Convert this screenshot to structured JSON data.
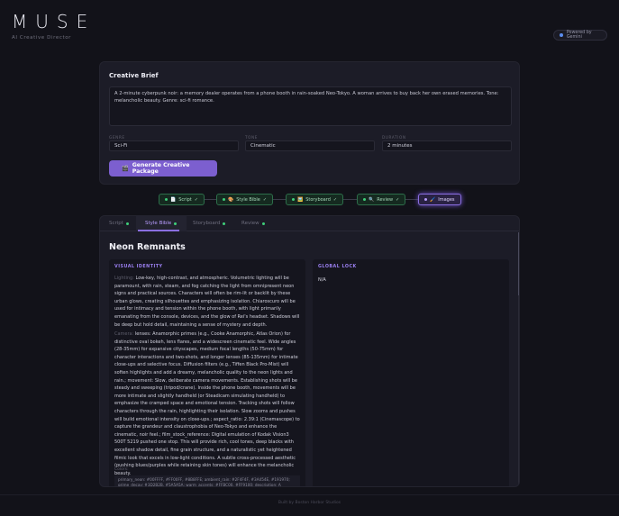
{
  "app": {
    "logo": "MUSE",
    "tagline": "AI Creative Director",
    "powered": "Powered by Gemini"
  },
  "brief": {
    "title": "Creative Brief",
    "prompt": "A 2-minute cyberpunk noir: a memory dealer operates from a phone booth in rain-soaked Neo-Tokyo. A woman arrives to buy back her own erased memories. Tone: melancholic beauty. Genre: sci-fi romance.",
    "genre_label": "GENRE",
    "genre_value": "Sci-Fi",
    "tone_label": "TONE",
    "tone_value": "Cinematic",
    "duration_label": "DURATION",
    "duration_value": "2 minutes",
    "generate_icon": "🎬",
    "generate_label": "Generate Creative Package"
  },
  "pipeline": [
    {
      "icon": "📄",
      "label": "Script",
      "check": "✓"
    },
    {
      "icon": "🎨",
      "label": "Style Bible",
      "check": "✓"
    },
    {
      "icon": "🖼️",
      "label": "Storyboard",
      "check": "✓"
    },
    {
      "icon": "🔍",
      "label": "Review",
      "check": "✓"
    },
    {
      "icon": "🖌️",
      "label": "Images",
      "check": ""
    }
  ],
  "tabs": [
    {
      "label": "Script"
    },
    {
      "label": "Style Bible"
    },
    {
      "label": "Storyboard"
    },
    {
      "label": "Review"
    }
  ],
  "style_bible": {
    "title": "Neon Remnants",
    "visual_identity_heading": "VISUAL IDENTITY",
    "lighting_key": "Lighting:",
    "lighting_text": "Low-key, high-contrast, and atmospheric. Volumetric lighting will be paramount, with rain, steam, and fog catching the light from omnipresent neon signs and practical sources. Characters will often be rim-lit or backlit by these urban glows, creating silhouettes and emphasizing isolation. Chiaroscuro will be used for intimacy and tension within the phone booth, with light primarily emanating from the console, devices, and the glow of Rei's headset. Shadows will be deep but hold detail, maintaining a sense of mystery and depth.",
    "camera_key": "Camera:",
    "camera_text": "lenses: Anamorphic primes (e.g., Cooke Anamorphic, Atlas Orion) for distinctive oval bokeh, lens flares, and a widescreen cinematic feel. Wide angles (28-35mm) for expansive cityscapes, medium focal lengths (50-75mm) for character interactions and two-shots, and longer lenses (85-135mm) for intimate close-ups and selective focus. Diffusion filters (e.g., Tiffen Black Pro-Mist) will soften highlights and add a dreamy, melancholic quality to the neon lights and rain.; movement: Slow, deliberate camera movements. Establishing shots will be steady and sweeping (tripod/crane). Inside the phone booth, movements will be more intimate and slightly handheld (or Steadicam simulating handheld) to emphasize the cramped space and emotional tension. Tracking shots will follow characters through the rain, highlighting their isolation. Slow zooms and pushes will build emotional intensity on close-ups.; aspect_ratio: 2.39:1 (Cinemascope) to capture the grandeur and claustrophobia of Neo-Tokyo and enhance the cinematic, noir feel.; film_stock_reference: Digital emulation of Kodak Vision3 500T 5219 pushed one stop. This will provide rich, cool tones, deep blacks with excellent shadow detail, fine grain structure, and a naturalistic yet heightened filmic look that excels in low-light conditions. A subtle cross-processed aesthetic (pushing blues/purples while retaining skin tones) will enhance the melancholic beauty.",
    "colors_key": "Colors:",
    "colors_text": "primary_neon: #00FFFF, #FF00FF, #8B8FFE; ambient_rain: #2F4F4F, #3A454E, #191970; grime_decay: #3D2B2B, #5A5A5A; warm_accents: #FFBC00, #FF9100; description: A dominant palette of deep",
    "global_lock_heading": "GLOBAL LOCK",
    "global_lock_value": "N/A"
  },
  "footer": "Built by Boston Harbor Studios"
}
